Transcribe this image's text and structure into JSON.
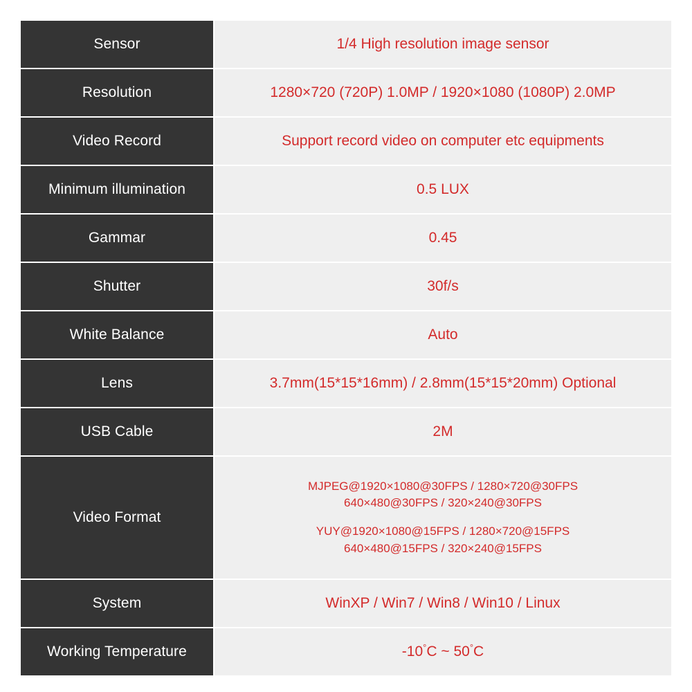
{
  "spec_table": {
    "label_color": "#343434",
    "value_bg_color": "#efefef",
    "value_text_color": "#d32b2b",
    "label_text_color": "#ffffff",
    "rows": [
      {
        "label": "Sensor",
        "value": "1/4 High resolution image sensor"
      },
      {
        "label": "Resolution",
        "value": "1280×720 (720P) 1.0MP / 1920×1080 (1080P) 2.0MP"
      },
      {
        "label": "Video Record",
        "value": "Support record video on computer etc equipments"
      },
      {
        "label": "Minimum illumination",
        "value": "0.5 LUX"
      },
      {
        "label": "Gammar",
        "value": "0.45"
      },
      {
        "label": "Shutter",
        "value": "30f/s"
      },
      {
        "label": "White Balance",
        "value": "Auto"
      },
      {
        "label": "Lens",
        "value": "3.7mm(15*15*16mm) / 2.8mm(15*15*20mm) Optional"
      },
      {
        "label": "USB Cable",
        "value": "2M"
      },
      {
        "label": "Video Format",
        "value_lines_block1": [
          "MJPEG@1920×1080@30FPS / 1280×720@30FPS",
          "640×480@30FPS / 320×240@30FPS"
        ],
        "value_lines_block2": [
          "YUY@1920×1080@15FPS / 1280×720@15FPS",
          "640×480@15FPS / 320×240@15FPS"
        ]
      },
      {
        "label": "System",
        "value": "WinXP / Win7 / Win8 / Win10 / Linux"
      },
      {
        "label": "Working Temperature",
        "value_parts": {
          "prefix": "-10",
          "degree1": "°",
          "unit1": "C ~ 50",
          "degree2": "°",
          "unit2": "C"
        }
      }
    ]
  }
}
